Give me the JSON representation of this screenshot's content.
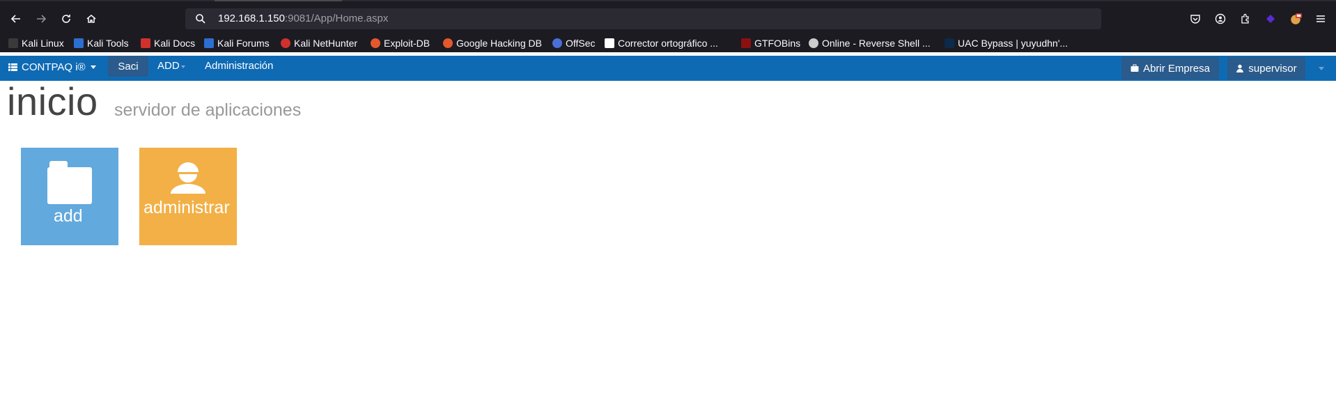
{
  "browser": {
    "url_host": "192.168.1.150",
    "url_rest": ":9081/App/Home.aspx",
    "bookmarks": [
      {
        "label": "Kali Linux",
        "color": "#3a3a3a"
      },
      {
        "label": "Kali Tools",
        "color": "#2c6fd1"
      },
      {
        "label": "Kali Docs",
        "color": "#d0312d"
      },
      {
        "label": "Kali Forums",
        "color": "#2c6fd1"
      },
      {
        "label": "Kali NetHunter",
        "color": "#d0312d"
      },
      {
        "label": "Exploit-DB",
        "color": "#e4582c"
      },
      {
        "label": "Google Hacking DB",
        "color": "#e4582c"
      },
      {
        "label": "OffSec",
        "color": "#4a6fd6"
      },
      {
        "label": "Corrector ortográfico ...",
        "color": "#ffffff"
      },
      {
        "label": "GTFOBins",
        "color": "#8b1010"
      },
      {
        "label": "Online - Reverse Shell ...",
        "color": "#cccccc"
      },
      {
        "label": "UAC Bypass | yuyudhn'...",
        "color": "#0d2a4a"
      }
    ]
  },
  "app": {
    "brand": "CONTPAQ i®",
    "menu": {
      "saci": "Saci",
      "add": "ADD",
      "admin": "Administración"
    },
    "right": {
      "abrir": "Abrir Empresa",
      "user": "supervisor"
    }
  },
  "page": {
    "title": "inicio",
    "subtitle": "servidor de aplicaciones"
  },
  "tiles": [
    {
      "label": "add",
      "icon": "folder-icon",
      "color": "#62a9dd"
    },
    {
      "label": "administrar",
      "icon": "user-icon",
      "color": "#f2b046"
    }
  ]
}
